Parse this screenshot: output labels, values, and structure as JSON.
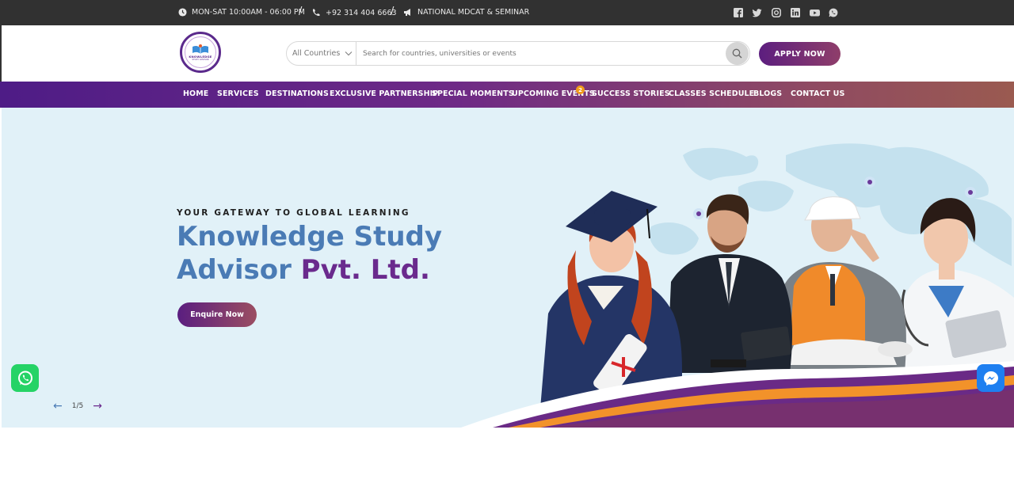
{
  "topbar": {
    "hours": "MON-SAT 10:00AM - 06:00 PM",
    "phone": "+92 314 404 6663",
    "announcement": "NATIONAL MDCAT & SEMINAR",
    "separator": "/",
    "social_icons": [
      "facebook-icon",
      "twitter-icon",
      "instagram-icon",
      "linkedin-icon",
      "youtube-icon",
      "whatsapp-icon"
    ]
  },
  "header": {
    "logo_text": "KNOWLEDGE",
    "logo_subtext": "STUDY ADVISOR",
    "country_select": "All Countries",
    "search_placeholder": "Search for countries, universities or events",
    "apply_label": "APPLY NOW"
  },
  "nav": {
    "items": [
      {
        "label": "HOME"
      },
      {
        "label": "SERVICES"
      },
      {
        "label": "DESTINATIONS"
      },
      {
        "label": "EXCLUSIVE PARTNERSHIP"
      },
      {
        "label": "SPECIAL MOMENTS"
      },
      {
        "label": "UPCOMING EVENTS"
      },
      {
        "label": "SUCCESS STORIES"
      },
      {
        "label": "CLASSES SCHEDULE"
      },
      {
        "label": "BLOGS"
      },
      {
        "label": "CONTACT US"
      }
    ],
    "events_badge": "2"
  },
  "hero": {
    "kicker": "YOUR GATEWAY TO GLOBAL LEARNING",
    "title_line1": "Knowledge Study",
    "title_line2_part1": "Advisor ",
    "title_line2_part2": "Pvt. Ltd.",
    "cta_label": "Enquire Now",
    "pager": "1/5",
    "prev_arrow": "←",
    "next_arrow": "→"
  },
  "colors": {
    "brand_purple": "#6a2a8d",
    "brand_blue": "#4a7bb5",
    "accent_orange": "#f09a1a",
    "topbar_bg": "#313131",
    "hero_bg": "#e1f1f8"
  }
}
